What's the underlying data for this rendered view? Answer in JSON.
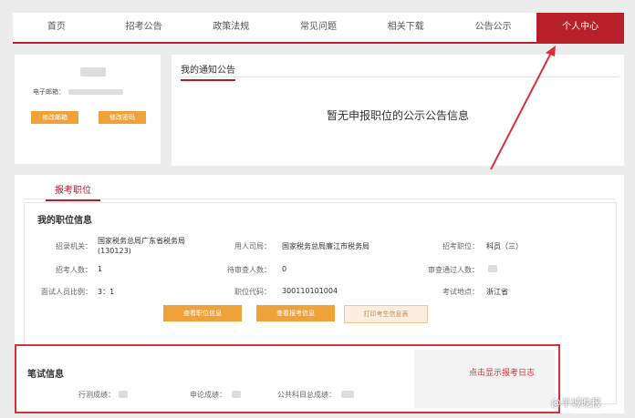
{
  "nav": {
    "items": [
      "首页",
      "招考公告",
      "政策法规",
      "常见问题",
      "相关下载",
      "公告公示",
      "个人中心"
    ],
    "active_index": 6
  },
  "user_card": {
    "email_label": "电子邮箱：",
    "buttons": [
      "修改邮箱",
      "修改密码"
    ]
  },
  "notice": {
    "title": "我的通知公告",
    "message": "暂无申报职位的公示公告信息"
  },
  "main": {
    "tab": "报考职位",
    "section_title": "我的职位信息",
    "fields": {
      "recruit_org_label": "招录机关：",
      "recruit_org_value": "国家税务总局广东省税务局(130123)",
      "employer_label": "用人司局：",
      "employer_value": "国家税务总局廉江市税务局",
      "position_label": "招考职位：",
      "position_value": "科员（三）",
      "count_label": "招考人数：",
      "count_value": "1",
      "pending_label": "待审查人数：",
      "pending_value": "0",
      "passed_label": "审查通过人数：",
      "ratio_label": "面试人员比例：",
      "ratio_value": "3：1",
      "code_label": "职位代码：",
      "code_value": "300110101004",
      "location_label": "考试地点：",
      "location_value": "浙江省"
    },
    "buttons": [
      "查看职位信息",
      "查看报考信息",
      "打印考生信息表"
    ]
  },
  "exam": {
    "title": "笔试信息",
    "link": "点击显示报考日志",
    "labels": [
      "行测成绩：",
      "申论成绩：",
      "公共科目总成绩："
    ]
  },
  "watermark": "@羊城晚报",
  "colors": {
    "brand": "#b8202a",
    "button": "#f0a23a",
    "highlight": "#d6323c"
  }
}
